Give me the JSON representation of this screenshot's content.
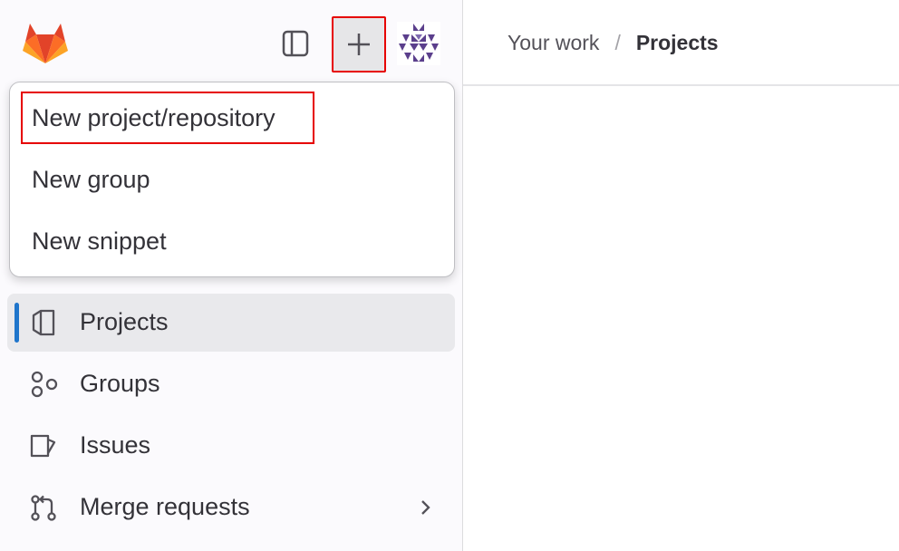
{
  "header": {
    "breadcrumb": {
      "parent": "Your work",
      "separator": "/",
      "current": "Projects"
    }
  },
  "toolbar": {
    "logo_icon": "gitlab-tanuki-logo",
    "toggle_icon": "sidebar-toggle-icon",
    "new_icon": "plus-icon",
    "avatar_icon": "identicon-avatar"
  },
  "new_menu": {
    "items": [
      {
        "label": "New project/repository",
        "highlighted": true
      },
      {
        "label": "New group"
      },
      {
        "label": "New snippet"
      }
    ]
  },
  "sidebar": {
    "items": [
      {
        "label": "Projects",
        "icon": "project-icon",
        "active": true
      },
      {
        "label": "Groups",
        "icon": "group-icon"
      },
      {
        "label": "Issues",
        "icon": "issues-icon"
      },
      {
        "label": "Merge requests",
        "icon": "merge-request-icon",
        "has_submenu": true
      }
    ]
  },
  "colors": {
    "accent": "#1f75cb",
    "highlight": "#e60000",
    "logo_orange": "#e24329",
    "avatar_purple": "#5b3f8c"
  }
}
